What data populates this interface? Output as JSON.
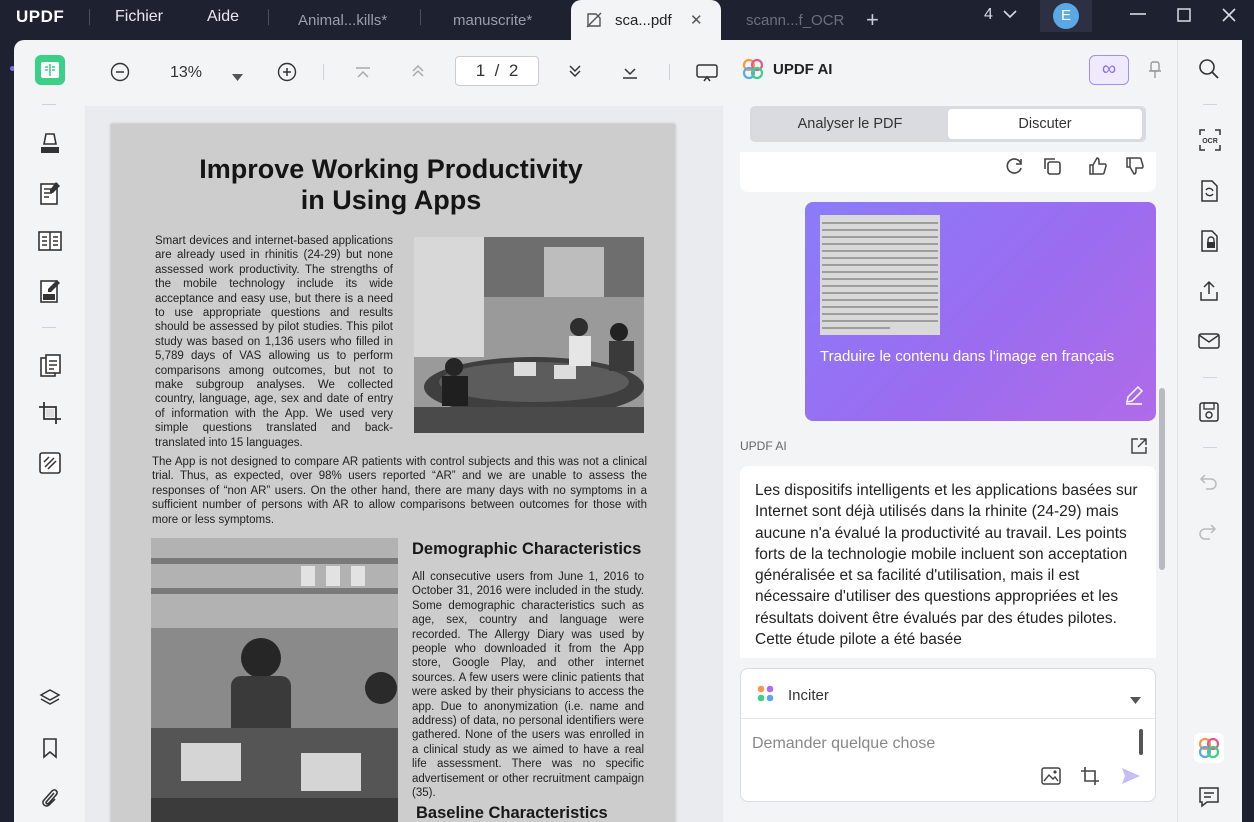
{
  "app": {
    "logo": "UPDF",
    "menu": [
      "Fichier",
      "Aide"
    ],
    "tabs": [
      {
        "label": "Animal...kills*"
      },
      {
        "label": "manuscrite*"
      },
      {
        "label": "sca...pdf"
      },
      {
        "label": "scann...f_OCR"
      }
    ],
    "window_count": "4",
    "avatar_initial": "E"
  },
  "toolbar": {
    "zoom": "13%",
    "page_current": "1",
    "page_separator": "/",
    "page_total": "2"
  },
  "document": {
    "title_line1": "Improve Working Productivity",
    "title_line2": "in Using Apps",
    "intro": "Smart devices and internet-based applications are already used in rhinitis (24-29) but none assessed work productivity. The strengths of the mobile technology include its wide acceptance and easy use, but there is a need to use appropriate questions and results should be assessed by pilot studies. This pilot study was based on 1,136 users who filled in 5,789 days of VAS allowing us to perform comparisons among outcomes, but not to make subgroup analyses. We collected country, language, age, sex and date of entry of information with the App. We used very simple questions translated and back-translated into 15 languages.",
    "para2": "The App is not designed to compare AR patients with control subjects and this was not a clinical trial. Thus, as expected, over 98% users reported “AR” and we are unable to assess the responses of “non AR” users. On the other hand, there are many days with no symptoms in a sufficient number of persons with AR to allow comparisons between outcomes for those with more or less symptoms.",
    "heading_demo": "Demographic Characteristics",
    "demo_text": "All consecutive users from June 1, 2016 to October 31, 2016 were included in the study. Some demographic characteristics such as age, sex, country and language were recorded. The Allergy Diary was used by people who downloaded it from the App store, Google Play, and other internet sources.",
    "demo_text2": "A few users were clinic patients that were asked by their physicians to access the app. Due to anonymization (i.e. name and address) of data, no personal identifiers were gathered. None of the users was enrolled in a clinical study as we aimed to have a real life assessment. There was no specific advertisement or other recruitment campaign (35).",
    "heading_baseline": "Baseline Characteristics"
  },
  "ai": {
    "title": "UPDF AI",
    "tab_analyze": "Analyser le PDF",
    "tab_chat": "Discuter",
    "user_message": "Traduire le contenu dans l'image en français",
    "response_label": "UPDF AI",
    "response_text": "Les dispositifs intelligents et les applications basées sur Internet sont déjà utilisés dans la rhinite (24-29) mais aucune n'a évalué la productivité au travail. Les points forts de la technologie mobile incluent son acceptation généralisée et sa facilité d'utilisation, mais il est nécessaire d'utiliser des questions appropriées et les résultats doivent être évalués par des études pilotes. Cette étude pilote a été basée",
    "prompt_label": "Inciter",
    "input_placeholder": "Demander quelque chose"
  },
  "colors": {
    "accent_green": "#3ccf87",
    "accent_purple": "#8a7cf8",
    "titlebar_bg": "#1e2130"
  },
  "icons": {
    "sidebar": [
      "reader-mode-icon",
      "highlighter-icon",
      "edit-text-icon",
      "organize-pages-icon",
      "form-icon",
      "convert-icon",
      "crop-icon",
      "protect-icon",
      "layers-icon",
      "bookmark-icon",
      "attachment-icon"
    ],
    "right_rail": [
      "search-icon",
      "ocr-icon",
      "convert-icon",
      "protect-icon",
      "share-icon",
      "email-icon",
      "save-icon",
      "undo-icon",
      "redo-icon",
      "updf-ai-icon",
      "comment-icon"
    ]
  }
}
